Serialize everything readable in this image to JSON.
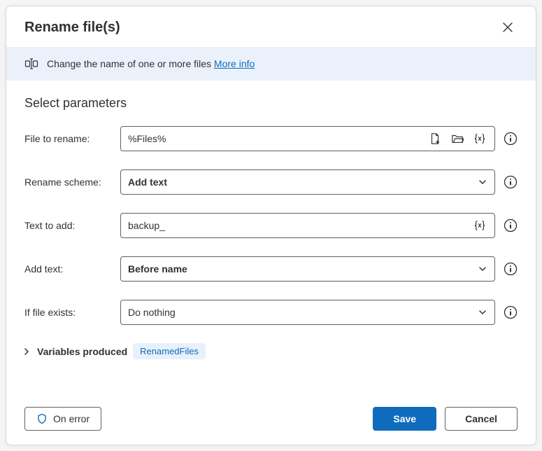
{
  "header": {
    "title": "Rename file(s)"
  },
  "info": {
    "text": "Change the name of one or more files ",
    "link": "More info"
  },
  "section_title": "Select parameters",
  "fields": {
    "file_to_rename": {
      "label": "File to rename:",
      "value": "%Files%"
    },
    "rename_scheme": {
      "label": "Rename scheme:",
      "value": "Add text"
    },
    "text_to_add": {
      "label": "Text to add:",
      "value": "backup_"
    },
    "add_text": {
      "label": "Add text:",
      "value": "Before name"
    },
    "if_file_exists": {
      "label": "If file exists:",
      "value": "Do nothing"
    }
  },
  "variables": {
    "label": "Variables produced",
    "badge": "RenamedFiles"
  },
  "footer": {
    "on_error": "On error",
    "save": "Save",
    "cancel": "Cancel"
  }
}
